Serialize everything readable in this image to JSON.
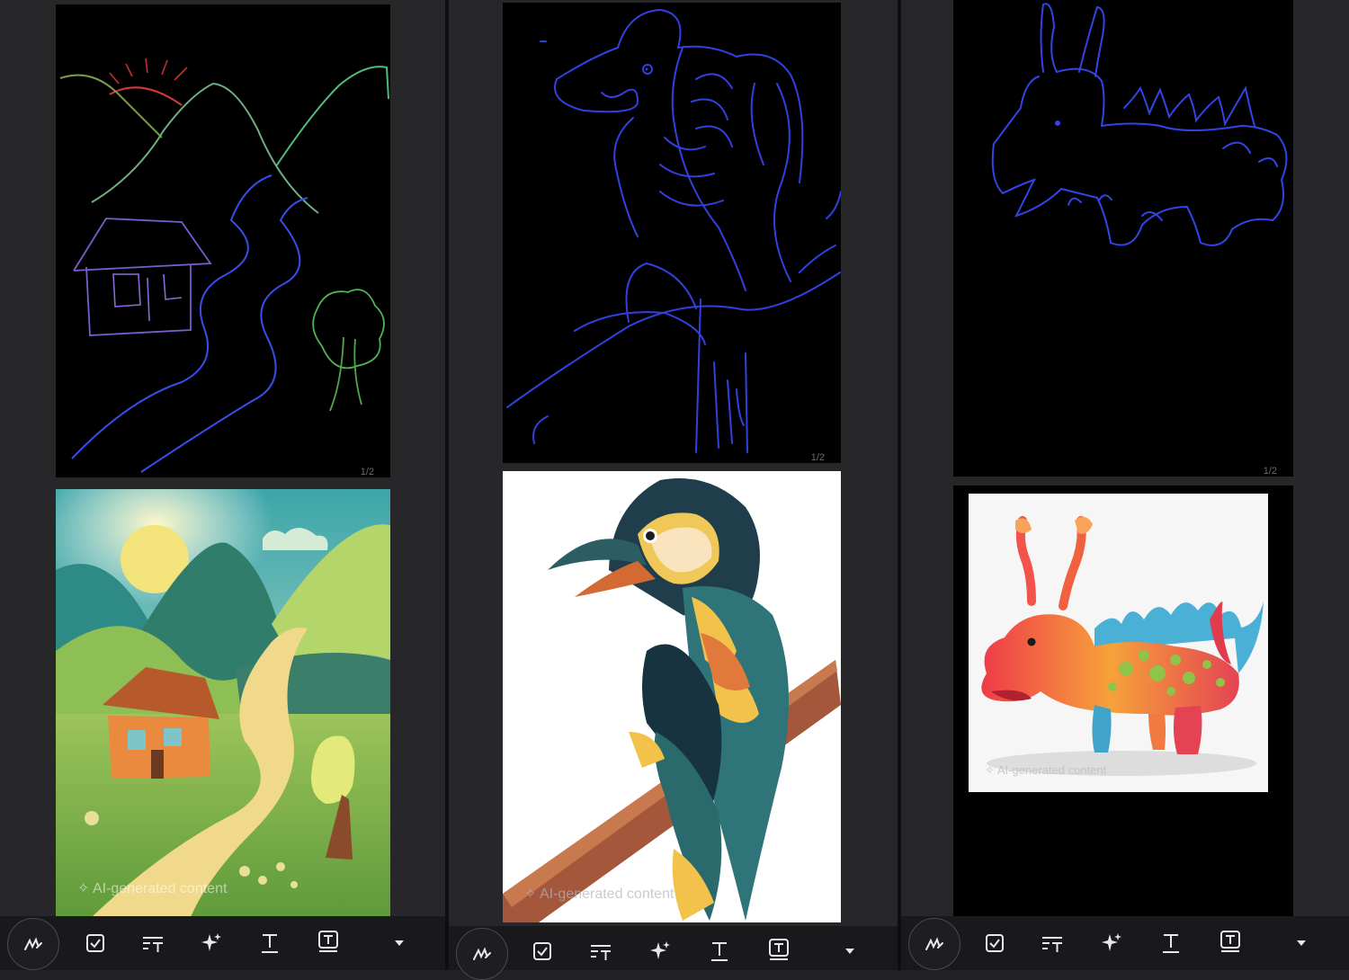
{
  "panels": [
    {
      "page_indicator": "1/2",
      "ai_label": "AI-generated content",
      "sketch_subject": "landscape-house-mountains-sketch",
      "result_subject": "landscape-house-mountains-ai-image"
    },
    {
      "page_indicator": "1/2",
      "ai_label": "AI-generated content",
      "sketch_subject": "bird-on-branch-sketch",
      "result_subject": "bird-on-branch-ai-image"
    },
    {
      "page_indicator": "1/2",
      "ai_label": "AI-generated content",
      "sketch_subject": "dragon-creature-sketch",
      "result_subject": "dragon-creature-ai-image"
    }
  ],
  "toolbar": {
    "tools": [
      {
        "name": "pen-tool",
        "icon": "pen-scribble-icon"
      },
      {
        "name": "checklist-tool",
        "icon": "checkbox-icon"
      },
      {
        "name": "text-format-tool",
        "icon": "text-format-icon"
      },
      {
        "name": "ai-assist-tool",
        "icon": "sparkle-icon"
      },
      {
        "name": "text-tool",
        "icon": "text-underline-icon"
      },
      {
        "name": "text-box-tool",
        "icon": "text-box-icon"
      },
      {
        "name": "more-tools",
        "icon": "caret-down-icon"
      }
    ]
  },
  "colors": {
    "background": "#222224",
    "toolbar": "#19191b",
    "sketch_blue": "#3340e0",
    "icon": "#e8e8ea"
  }
}
